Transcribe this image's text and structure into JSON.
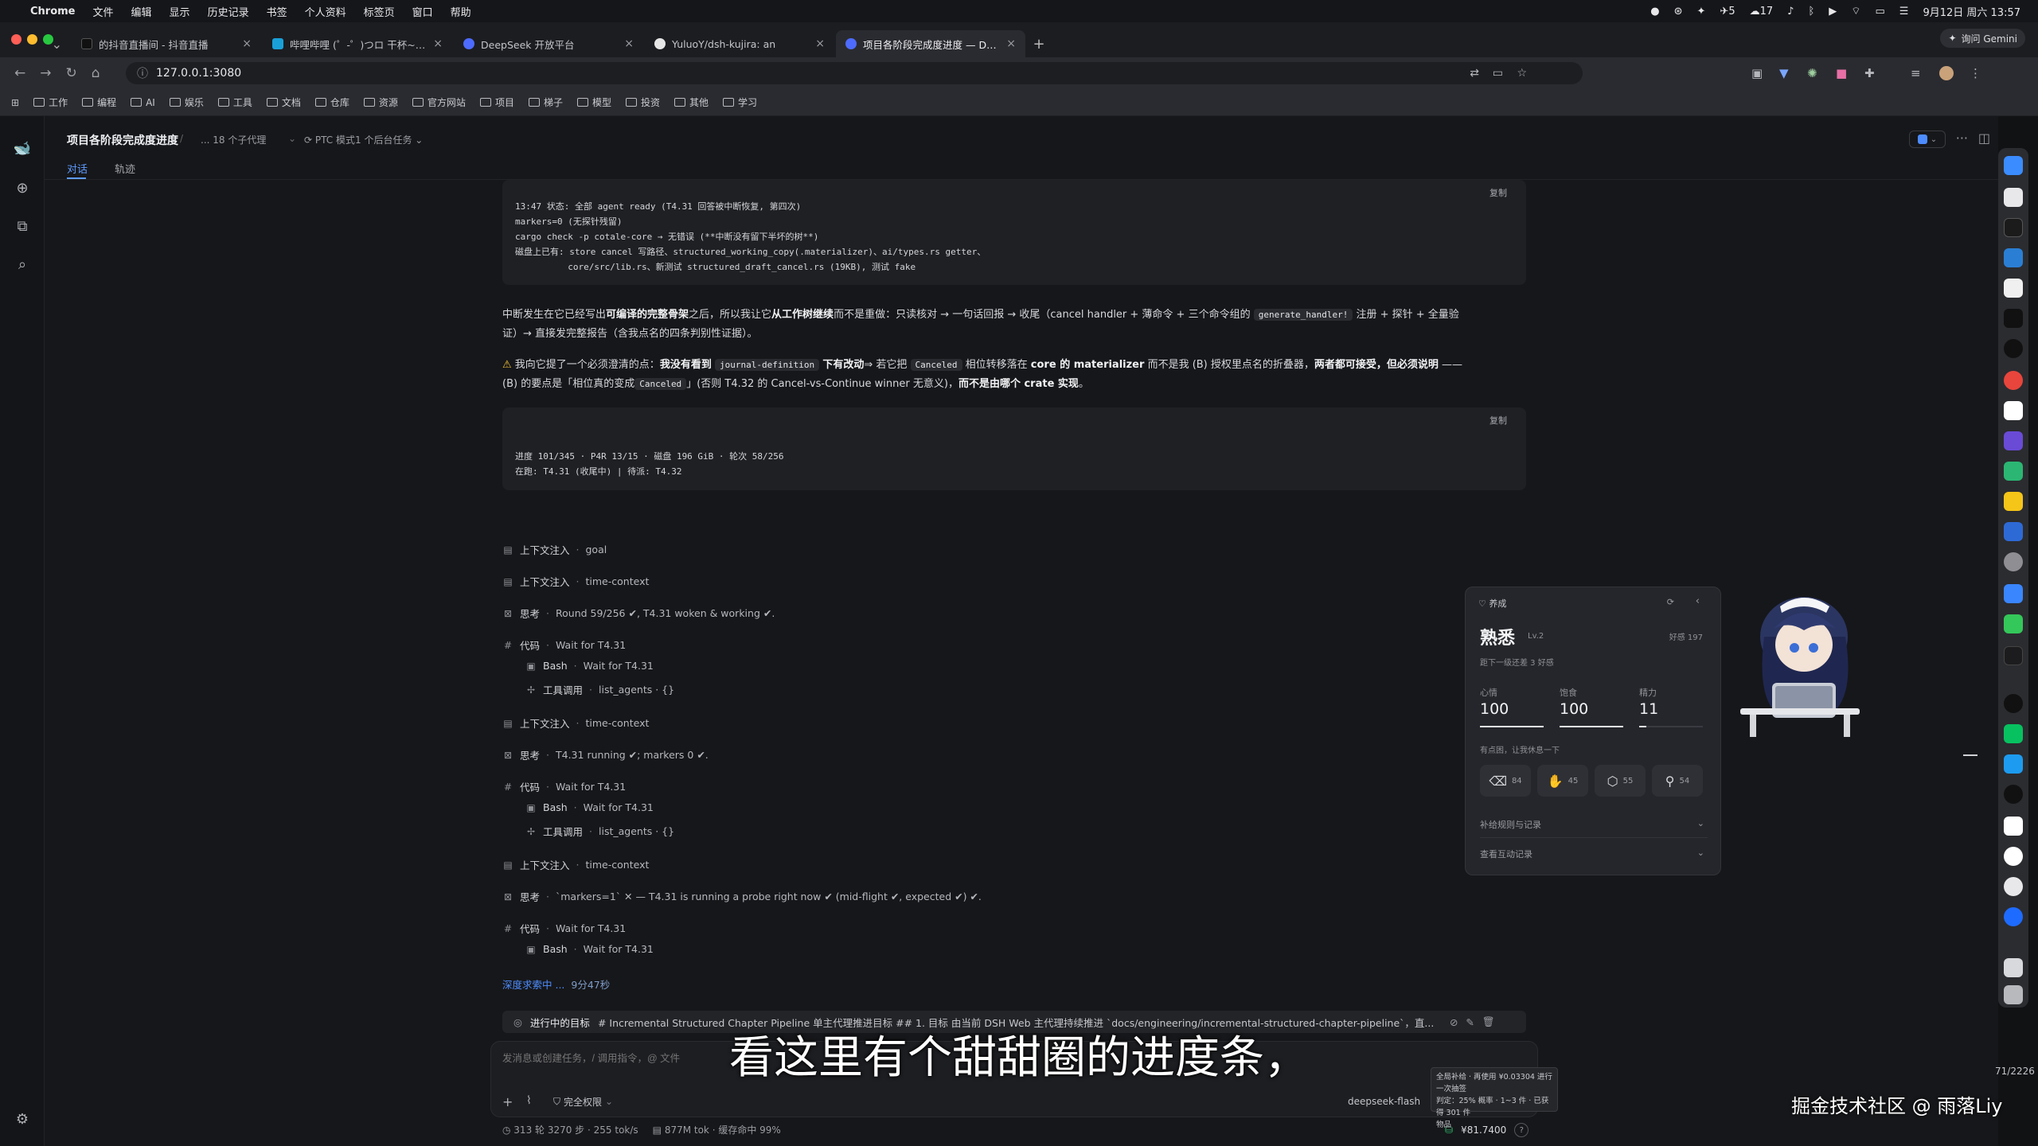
{
  "menubar": {
    "items": [
      "Chrome",
      "文件",
      "编辑",
      "显示",
      "历史记录",
      "书签",
      "个人资料",
      "标签页",
      "窗口",
      "帮助"
    ],
    "clock": "9月12日 周六 13:57",
    "status_counts": [
      "5",
      "17"
    ]
  },
  "tabs": [
    {
      "title": "的抖音直播间 - 抖音直播",
      "color": "#111"
    },
    {
      "title": "哔哩哔哩 (゜-゜)つロ 干杯~-bi",
      "color": "#19a0d8"
    },
    {
      "title": "DeepSeek 开放平台",
      "color": "#4d6bfe"
    },
    {
      "title": "YuluoY/dsh-kujira: an",
      "color": "#24292f"
    },
    {
      "title": "项目各阶段完成度进度 — Deep",
      "color": "#4d6bfe"
    }
  ],
  "browser": {
    "url": "127.0.0.1:3080",
    "gemini": "询问 Gemini"
  },
  "bookmarks": [
    "工作",
    "编程",
    "AI",
    "娱乐",
    "工具",
    "文档",
    "仓库",
    "资源",
    "官方网站",
    "项目",
    "梯子",
    "模型",
    "投资",
    "其他",
    "学习"
  ],
  "header": {
    "title": "项目各阶段完成度进度",
    "subagents": "... 18 个子代理",
    "ptc": "PTC 模式",
    "bgtask": "1 个后台任务",
    "tab_chat": "对话",
    "tab_track": "轨迹"
  },
  "code1": {
    "copy": "复制",
    "lines": [
      "13:47 状态: 全部 agent ready (T4.31 回答被中断恢复, 第四次)",
      "markers=0 (无探针残留)",
      "cargo check -p cotale-core → 无错误 (**中断没有留下半坏的树**)",
      "磁盘上已有: store cancel 写路径、structured_working_copy(.materializer)、ai/types.rs getter、",
      "          core/src/lib.rs、新测试 structured_draft_cancel.rs (19KB), 测试 fake"
    ]
  },
  "para1": {
    "a": "中断发生在它已经写出",
    "b": "可编译的完整骨架",
    "c": "之后，所以我让它",
    "d": "从工作树继续",
    "e": "而不是重做：只读核对 → 一句话回报 → 收尾（cancel handler + 薄命令 + 三个命令组的",
    "code": "generate_handler!",
    "f": "注册 + 探针 + 全量验",
    "g": "证）→ 直接发完整报告（含我点名的四条判别性证据）。"
  },
  "para2": {
    "a": "我向它提了一个必须澄清的点：",
    "b": "我没有看到",
    "c1": "journal-definition",
    "c": "下有改动",
    "d": "⇒ 若它把",
    "c2": "Canceled",
    "e": "相位转移落在",
    "f": "core 的 materializer",
    "g": "而不是我 (B) 授权里点名的折叠器，",
    "h": "两者都可接受，但必须说明",
    "i": "——",
    "j": "(B) 的要点是「相位真的变成",
    "c3": "Canceled",
    "k": "」(否则 T4.32 的 Cancel-vs-Continue winner 无意义)，",
    "l": "而不是由哪个 crate 实现",
    "m": "。"
  },
  "code2": {
    "copy": "复制",
    "lines": [
      "进度 101/345 · P4R 13/15 · 磁盘 196 GiB · 轮次 58/256",
      "在跑: T4.31 (收尾中) | 待派: T4.32"
    ]
  },
  "steps": [
    {
      "icon": "▤",
      "k": "上下文注入",
      "v": "goal"
    },
    {
      "icon": "▤",
      "k": "上下文注入",
      "v": "time-context"
    },
    {
      "icon": "⊠",
      "k": "思考",
      "v": "Round 59/256 ✔, T4.31 woken & working ✔."
    },
    {
      "icon": "#",
      "k": "代码",
      "v": "Wait for T4.31"
    },
    {
      "icon": "▣",
      "k": "Bash",
      "v": "Wait for T4.31"
    },
    {
      "icon": "✢",
      "k": "工具调用",
      "v": "list_agents · {}"
    },
    {
      "icon": "▤",
      "k": "上下文注入",
      "v": "time-context"
    },
    {
      "icon": "⊠",
      "k": "思考",
      "v": "T4.31 running ✔; markers 0 ✔."
    },
    {
      "icon": "#",
      "k": "代码",
      "v": "Wait for T4.31"
    },
    {
      "icon": "▣",
      "k": "Bash",
      "v": "Wait for T4.31"
    },
    {
      "icon": "✢",
      "k": "工具调用",
      "v": "list_agents · {}"
    },
    {
      "icon": "▤",
      "k": "上下文注入",
      "v": "time-context"
    },
    {
      "icon": "⊠",
      "k": "思考",
      "v": "`markers=1` ✕ — T4.31 is running a probe right now ✔ (mid-flight ✔, expected ✔) ✔."
    },
    {
      "icon": "#",
      "k": "代码",
      "v": "Wait for T4.31"
    },
    {
      "icon": "▣",
      "k": "Bash",
      "v": "Wait for T4.31"
    }
  ],
  "thinking": {
    "label": "深度求索中 ...",
    "time": "9分47秒"
  },
  "goal": {
    "label": "进行中的目标",
    "text": "# Incremental Structured Chapter Pipeline 单主代理推进目标 ## 1. 目标 由当前 DSH Web 主代理持续推进 `docs/engineering/incremental-structured-chapter-pipeline`，直..."
  },
  "composer": {
    "placeholder": "发消息或创建任务，/ 调用指令，@ 文件",
    "permission": "完全权限",
    "model": "deepseek-flash",
    "cost_lines": [
      "全局补给 · 再使用 ¥0.03304 进行一次抽签",
      "判定：25% 概率 · 1~3 件 · 已获得 301 件",
      "物品"
    ]
  },
  "status": {
    "rounds": "313 轮 3270 步",
    "speed": "255 tok/s",
    "tokens": "877M tok · 缓存命中 99%",
    "balance": "¥81.7400",
    "scroll": "71/2226"
  },
  "panel": {
    "section": "养成",
    "level_name": "熟悉",
    "level": "Lv.2",
    "affinity": "好感 197",
    "next": "距下一级还差 3 好感",
    "mood_label": "心情",
    "mood": "100",
    "mood_frac": 1.0,
    "hunger_label": "饱食",
    "hunger": "100",
    "hunger_frac": 1.0,
    "energy_label": "精力",
    "energy": "11",
    "energy_frac": 0.11,
    "hint": "有点困，让我休息一下",
    "actions": [
      {
        "glyph": "⌫",
        "n": "84"
      },
      {
        "glyph": "✋",
        "n": "45"
      },
      {
        "glyph": "⬡",
        "n": "55"
      },
      {
        "glyph": "⚲",
        "n": "54"
      }
    ],
    "row1": "补给规则与记录",
    "row2": "查看互动记录"
  },
  "subtitle": "看这里有个甜甜圈的进度条，",
  "watermark": "掘金技术社区 @ 雨落Liy"
}
